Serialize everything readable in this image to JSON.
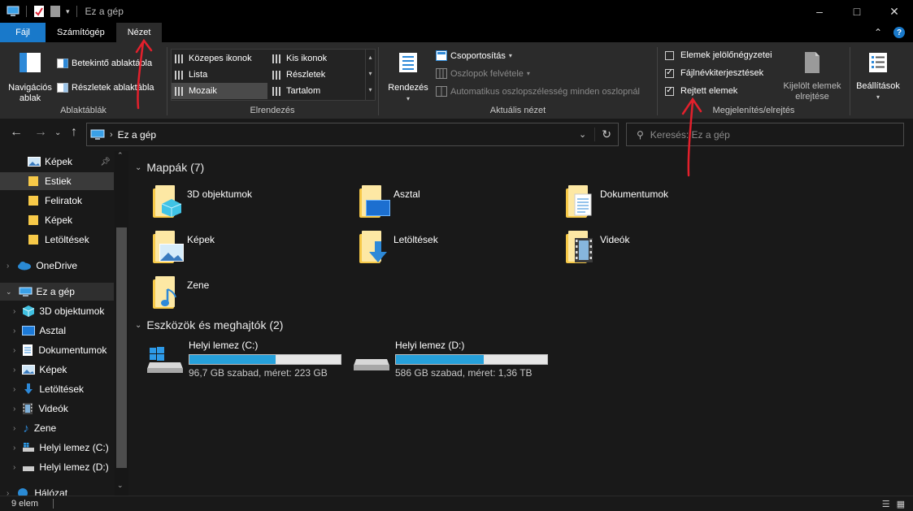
{
  "window": {
    "title": "Ez a gép",
    "controls": [
      "–",
      "□",
      "✕"
    ]
  },
  "tabs": [
    {
      "label": "Fájl"
    },
    {
      "label": "Számítógép"
    },
    {
      "label": "Nézet"
    }
  ],
  "ribbon": {
    "panes": {
      "nav_label": "Navigációs ablak",
      "nav_line1": "Navigációs",
      "nav_line2": "ablak",
      "preview": "Betekintő ablaktábla",
      "details": "Részletek ablaktábla",
      "group": "Ablaktáblák"
    },
    "layout": {
      "items": [
        "Közepes ikonok",
        "Kis ikonok",
        "Lista",
        "Részletek",
        "Mozaik",
        "Tartalom"
      ],
      "selected": "Mozaik",
      "group": "Elrendezés"
    },
    "current_view": {
      "sort": "Rendezés",
      "group_by": "Csoportosítás",
      "add_columns": "Oszlopok felvétele",
      "autosize": "Automatikus oszlopszélesség minden oszlopnál",
      "group": "Aktuális nézet"
    },
    "show_hide": {
      "checkboxes": [
        {
          "label": "Elemek jelölőnégyzetei",
          "checked": false
        },
        {
          "label": "Fájlnévkiterjesztések",
          "checked": true
        },
        {
          "label": "Rejtett elemek",
          "checked": true
        }
      ],
      "hide_selected_line1": "Kijelölt elemek",
      "hide_selected_line2": "elrejtése",
      "group": "Megjelenítés/elrejtés"
    },
    "options": "Beállítások"
  },
  "address": {
    "path": "Ez a gép",
    "search_placeholder": "Keresés: Ez a gép"
  },
  "sidebar": {
    "items": [
      {
        "label": "Képek",
        "pinned": true
      },
      {
        "label": "Estiek"
      },
      {
        "label": "Feliratok"
      },
      {
        "label": "Képek"
      },
      {
        "label": "Letöltések"
      },
      {
        "label": "OneDrive"
      },
      {
        "label": "Ez a gép"
      },
      {
        "label": "3D objektumok"
      },
      {
        "label": "Asztal"
      },
      {
        "label": "Dokumentumok"
      },
      {
        "label": "Képek"
      },
      {
        "label": "Letöltések"
      },
      {
        "label": "Videók"
      },
      {
        "label": "Zene"
      },
      {
        "label": "Helyi lemez (C:)"
      },
      {
        "label": "Helyi lemez (D:)"
      },
      {
        "label": "Hálózat"
      }
    ]
  },
  "content": {
    "folders_header": "Mappák (7)",
    "folders": [
      "3D objektumok",
      "Asztal",
      "Dokumentumok",
      "Képek",
      "Letöltések",
      "Videók",
      "Zene"
    ],
    "drives_header": "Eszközök és meghajtók (2)",
    "drives": [
      {
        "name": "Helyi lemez (C:)",
        "info": "96,7 GB szabad, méret: 223 GB",
        "used_fraction": 0.57
      },
      {
        "name": "Helyi lemez (D:)",
        "info": "586 GB szabad, méret: 1,36 TB",
        "used_fraction": 0.58
      }
    ]
  },
  "status": {
    "count": "9 elem"
  },
  "colors": {
    "accent": "#1979ca",
    "drive_bar": "#26a0da",
    "annotation": "#e3202c"
  }
}
